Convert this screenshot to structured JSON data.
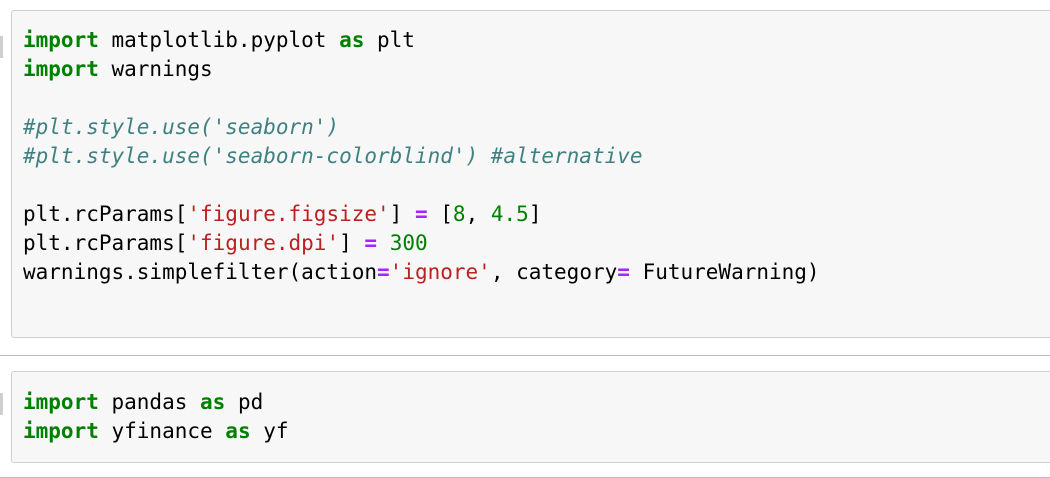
{
  "cells": [
    {
      "lines": [
        [
          {
            "t": "kw",
            "v": "import"
          },
          {
            "t": "tx",
            "v": " matplotlib.pyplot "
          },
          {
            "t": "kw",
            "v": "as"
          },
          {
            "t": "tx",
            "v": " plt"
          }
        ],
        [
          {
            "t": "kw",
            "v": "import"
          },
          {
            "t": "tx",
            "v": " warnings"
          }
        ],
        [],
        [
          {
            "t": "cm",
            "v": "#plt.style.use('seaborn')"
          }
        ],
        [
          {
            "t": "cm",
            "v": "#plt.style.use('seaborn-colorblind') #alternative"
          }
        ],
        [],
        [
          {
            "t": "tx",
            "v": "plt.rcParams["
          },
          {
            "t": "str",
            "v": "'figure.figsize'"
          },
          {
            "t": "tx",
            "v": "] "
          },
          {
            "t": "op",
            "v": "="
          },
          {
            "t": "tx",
            "v": " ["
          },
          {
            "t": "num",
            "v": "8"
          },
          {
            "t": "tx",
            "v": ", "
          },
          {
            "t": "num",
            "v": "4.5"
          },
          {
            "t": "tx",
            "v": "]"
          }
        ],
        [
          {
            "t": "tx",
            "v": "plt.rcParams["
          },
          {
            "t": "str",
            "v": "'figure.dpi'"
          },
          {
            "t": "tx",
            "v": "] "
          },
          {
            "t": "op",
            "v": "="
          },
          {
            "t": "tx",
            "v": " "
          },
          {
            "t": "num",
            "v": "300"
          }
        ],
        [
          {
            "t": "tx",
            "v": "warnings.simplefilter(action"
          },
          {
            "t": "op",
            "v": "="
          },
          {
            "t": "str",
            "v": "'ignore'"
          },
          {
            "t": "tx",
            "v": ", category"
          },
          {
            "t": "op",
            "v": "="
          },
          {
            "t": "tx",
            "v": " FutureWarning)"
          }
        ]
      ]
    },
    {
      "lines": [
        [
          {
            "t": "kw",
            "v": "import"
          },
          {
            "t": "tx",
            "v": " pandas "
          },
          {
            "t": "kw",
            "v": "as"
          },
          {
            "t": "tx",
            "v": " pd"
          }
        ],
        [
          {
            "t": "kw",
            "v": "import"
          },
          {
            "t": "tx",
            "v": " yfinance "
          },
          {
            "t": "kw",
            "v": "as"
          },
          {
            "t": "tx",
            "v": " yf"
          }
        ]
      ]
    }
  ]
}
